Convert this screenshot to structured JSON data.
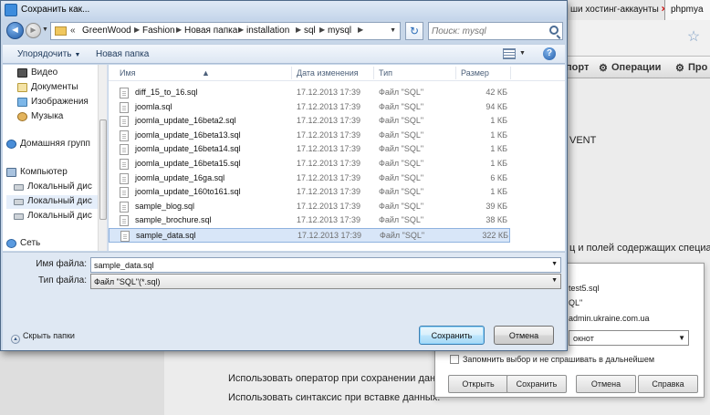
{
  "browser": {
    "tabs": [
      {
        "label": "ши хостинг-аккаунты"
      },
      {
        "label": "phpmya"
      }
    ],
    "tab_close": "×",
    "bookmark_star": "☆",
    "menu": {
      "export": "порт",
      "operations": "Операции",
      "more": "Про"
    },
    "background_text": {
      "event": "VENT",
      "tables_hint": "ц и полей содержащих специаль",
      "save_statement": "Использовать оператор при сохранении данных:",
      "insert_syntax": "Использовать синтаксис при вставке данных:"
    }
  },
  "download_dialog": {
    "file_line": "test5.sql",
    "type_line": "QL\"",
    "site_line": "admin.ukraine.com.ua",
    "select_value": "окнот",
    "remember": "Запомнить выбор и не спрашивать в дальнейшем",
    "buttons": {
      "open": "Открыть",
      "save": "Сохранить",
      "cancel": "Отмена",
      "help": "Справка"
    }
  },
  "dialog": {
    "title": "Сохранить как...",
    "breadcrumb": [
      "GreenWood",
      "Fashion",
      "Новая папка",
      "installation",
      "sql",
      "mysql"
    ],
    "search_placeholder": "Поиск: mysql",
    "toolbar": {
      "organize": "Упорядочить",
      "new_folder": "Новая папка"
    },
    "nav": {
      "videos": "Видео",
      "documents": "Документы",
      "images": "Изображения",
      "music": "Музыка",
      "homegroup": "Домашняя групп",
      "computer": "Компьютер",
      "local_disk_1": "Локальный дис",
      "local_disk_2": "Локальный дис",
      "local_disk_3": "Локальный дис",
      "network": "Сеть"
    },
    "columns": {
      "name": "Имя",
      "date": "Дата изменения",
      "type": "Тип",
      "size": "Размер"
    },
    "files": [
      {
        "name": "diff_15_to_16.sql",
        "date": "17.12.2013 17:39",
        "type": "Файл \"SQL\"",
        "size": "42 КБ"
      },
      {
        "name": "joomla.sql",
        "date": "17.12.2013 17:39",
        "type": "Файл \"SQL\"",
        "size": "94 КБ"
      },
      {
        "name": "joomla_update_16beta2.sql",
        "date": "17.12.2013 17:39",
        "type": "Файл \"SQL\"",
        "size": "1 КБ"
      },
      {
        "name": "joomla_update_16beta13.sql",
        "date": "17.12.2013 17:39",
        "type": "Файл \"SQL\"",
        "size": "1 КБ"
      },
      {
        "name": "joomla_update_16beta14.sql",
        "date": "17.12.2013 17:39",
        "type": "Файл \"SQL\"",
        "size": "1 КБ"
      },
      {
        "name": "joomla_update_16beta15.sql",
        "date": "17.12.2013 17:39",
        "type": "Файл \"SQL\"",
        "size": "1 КБ"
      },
      {
        "name": "joomla_update_16ga.sql",
        "date": "17.12.2013 17:39",
        "type": "Файл \"SQL\"",
        "size": "6 КБ"
      },
      {
        "name": "joomla_update_160to161.sql",
        "date": "17.12.2013 17:39",
        "type": "Файл \"SQL\"",
        "size": "1 КБ"
      },
      {
        "name": "sample_blog.sql",
        "date": "17.12.2013 17:39",
        "type": "Файл \"SQL\"",
        "size": "39 КБ"
      },
      {
        "name": "sample_brochure.sql",
        "date": "17.12.2013 17:39",
        "type": "Файл \"SQL\"",
        "size": "38 КБ"
      },
      {
        "name": "sample_data.sql",
        "date": "17.12.2013 17:39",
        "type": "Файл \"SQL\"",
        "size": "322 КБ",
        "selected": true
      }
    ],
    "filename_label": "Имя файла:",
    "filename_value": "sample_data.sql",
    "filetype_label": "Тип файла:",
    "filetype_value": "Файл \"SQL\"(*.sql)",
    "hide_folders": "Скрыть папки",
    "save_button": "Сохранить",
    "cancel_button": "Отмена"
  },
  "colors": {
    "accent": "#3c7fb1",
    "selection": "#d8e6f8",
    "title_bar": "#c4d5ea"
  }
}
